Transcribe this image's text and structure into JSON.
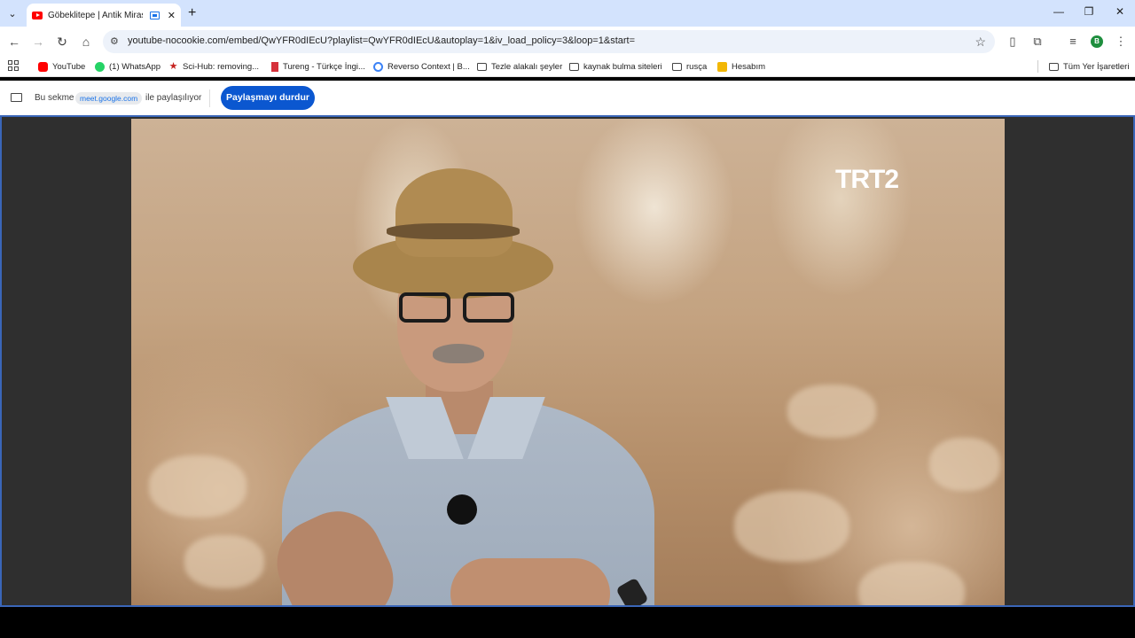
{
  "browser": {
    "tab": {
      "title": "Göbeklitepe | Antik Miras |",
      "close": "✕"
    },
    "new_tab": "+",
    "window_controls": {
      "minimize": "—",
      "restore": "❐",
      "close": "✕"
    },
    "address": {
      "url": "youtube-nocookie.com/embed/QwYFR0dIEcU?playlist=QwYFR0dIEcU&autoplay=1&iv_load_policy=3&loop=1&start="
    },
    "profile_initial": "B"
  },
  "bookmarks": [
    {
      "label": "YouTube",
      "icon": "youtube-icon"
    },
    {
      "label": "(1) WhatsApp",
      "icon": "whatsapp-icon"
    },
    {
      "label": "Sci-Hub: removing...",
      "icon": "star-icon"
    },
    {
      "label": "Tureng - Türkçe İngi...",
      "icon": "tureng-icon"
    },
    {
      "label": "Reverso Context | B...",
      "icon": "reverso-icon"
    },
    {
      "label": "Tezle alakalı şeyler",
      "icon": "folder-icon"
    },
    {
      "label": "kaynak bulma siteleri",
      "icon": "folder-icon"
    },
    {
      "label": "rusça",
      "icon": "folder-icon"
    },
    {
      "label": "Hesabım",
      "icon": "account-icon"
    }
  ],
  "all_bookmarks": "Tüm Yer İşaretleri",
  "sharebar": {
    "prefix": "Bu sekme",
    "chip": "meet.google.com",
    "suffix": "ile paylaşılıyor",
    "stop_button": "Paylaşmayı durdur"
  },
  "video": {
    "channel_logo": "TRT2"
  },
  "colors": {
    "tabstrip": "#d3e3fd",
    "stop_button": "#0b57d0",
    "share_border": "#3a66b8"
  }
}
